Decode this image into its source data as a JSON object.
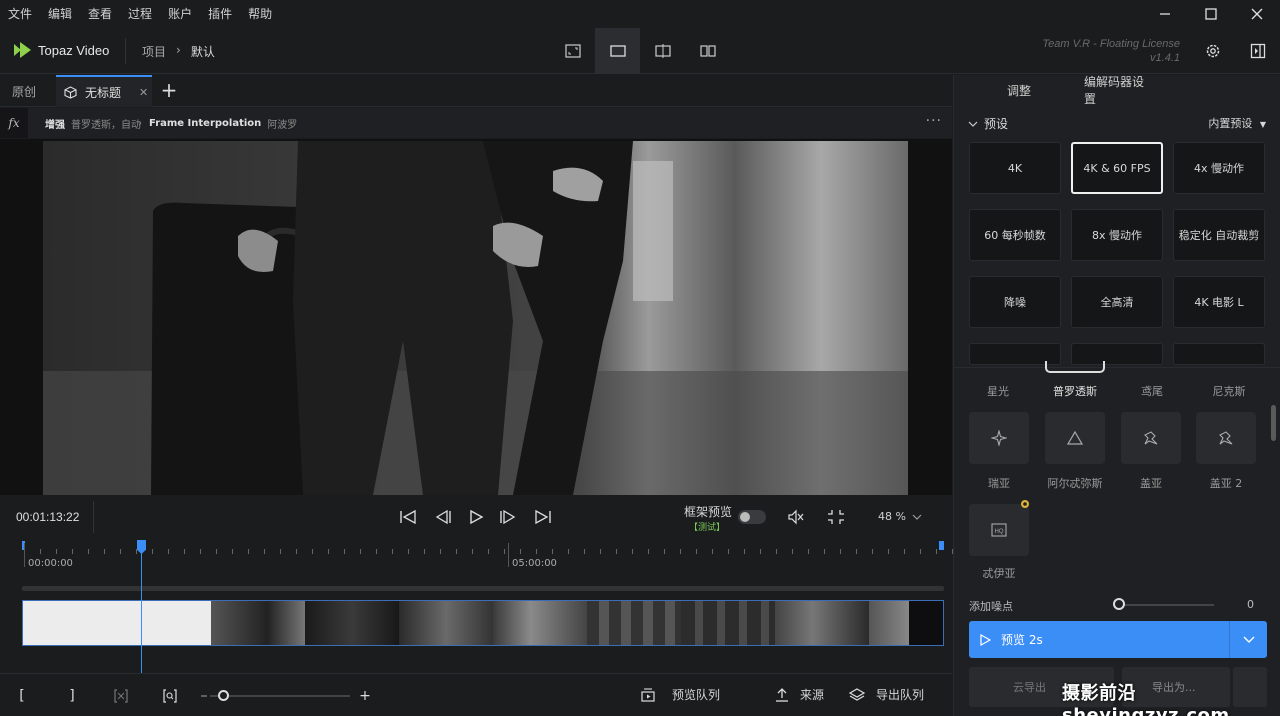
{
  "menu": [
    "文件",
    "编辑",
    "查看",
    "过程",
    "账户",
    "插件",
    "帮助"
  ],
  "window_controls": {
    "minimize": "—",
    "maximize": "☐",
    "close": "✕"
  },
  "app": {
    "name": "Topaz Video"
  },
  "breadcrumb": {
    "parent": "项目",
    "separator": "›",
    "current": "默认"
  },
  "license": {
    "line1": "Team V.R - Floating License",
    "line2": "v1.4.1"
  },
  "tabs": {
    "original": "原创",
    "untitled": "无标题",
    "close": "✕",
    "add": "+"
  },
  "fx": {
    "icon": "fx",
    "step1_bold": "增强",
    "step1_sub": "普罗透斯，自动",
    "arrow": "›",
    "step2_bold": "Frame Interpolation",
    "step2_sub": "阿波罗",
    "more": "···"
  },
  "transport": {
    "timecode": "00:01:13:22",
    "frame_preview": "框架预览",
    "test_badge": "【测试】",
    "zoom": "48 %"
  },
  "timeline": {
    "start_label": "00:00:00",
    "mid_label": "05:00:00",
    "playhead_fraction": 0.127
  },
  "bottom": {
    "mark_in": "[",
    "mark_out": "]",
    "zoom_plus": "+",
    "preview_queue": "预览队列",
    "source": "来源",
    "export_queue": "导出队列"
  },
  "panel": {
    "tabs": [
      "调整",
      "编解码器设置"
    ],
    "presets_title": "预设",
    "builtin_presets": "内置预设",
    "presets": [
      "4K",
      "4K & 60 FPS",
      "4x 慢动作",
      "60 每秒帧数",
      "8x 慢动作",
      "稳定化 自动裁剪",
      "降噪",
      "全高清",
      "4K 电影 L"
    ],
    "selected_preset": "4K & 60 FPS",
    "model_labels_row1": [
      "星光",
      "普罗透斯",
      "鸢尾",
      "尼克斯"
    ],
    "active_model": "普罗透斯",
    "model_labels_row2": [
      "瑞亚",
      "阿尔忒弥斯",
      "盖亚",
      "盖亚 2"
    ],
    "model_labels_row3": [
      "忒伊亚"
    ],
    "slider_label": "添加噪点",
    "slider_value": "0",
    "preview_button": "预览 2s",
    "lower_left_label": "云导出",
    "lower_right_label": "导出为..."
  },
  "watermark": "摄影前沿 sheyingzyz.com",
  "colors": {
    "accent": "#3a8ef6",
    "background": "#1b1c1e",
    "panel": "#1f2023",
    "test_green": "#7cc95a"
  }
}
